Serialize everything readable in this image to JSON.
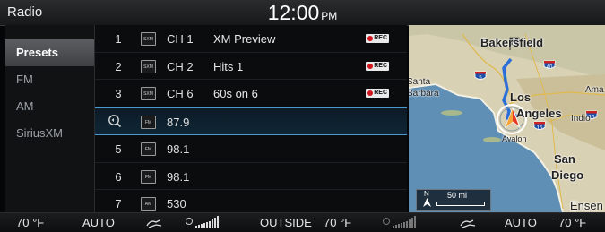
{
  "header": {
    "app_title": "Radio",
    "clock": "12:00",
    "ampm": "PM"
  },
  "sidebar": {
    "items": [
      {
        "label": "Presets",
        "active": true
      },
      {
        "label": "FM",
        "active": false
      },
      {
        "label": "AM",
        "active": false
      },
      {
        "label": "SiriusXM",
        "active": false
      }
    ]
  },
  "presets": [
    {
      "num": "1",
      "badge": "SXM",
      "channel": "CH 1",
      "name": "XM Preview",
      "rec": "REC"
    },
    {
      "num": "2",
      "badge": "SXM",
      "channel": "CH 2",
      "name": "Hits 1",
      "rec": "REC"
    },
    {
      "num": "3",
      "badge": "SXM",
      "channel": "CH 6",
      "name": "60s on 6",
      "rec": "REC"
    },
    {
      "num": "",
      "badge": "FM",
      "channel": "87.9",
      "name": "",
      "rec": ""
    },
    {
      "num": "5",
      "badge": "FM",
      "channel": "98.1",
      "name": "",
      "rec": ""
    },
    {
      "num": "6",
      "badge": "FM",
      "channel": "98.1",
      "name": "",
      "rec": ""
    },
    {
      "num": "7",
      "badge": "AM",
      "channel": "530",
      "name": "",
      "rec": ""
    }
  ],
  "map": {
    "labels": {
      "bakersfield": "Bakersfield",
      "los": "Los",
      "angeles": "Angeles",
      "santa": "Santa",
      "barbara": "Barbara",
      "indio": "Indio",
      "avalon": "Avalon",
      "san": "San",
      "diego": "Diego",
      "ensenada": "Ensen",
      "ama": "Ama"
    },
    "highways": {
      "i5": "5",
      "i40": "40",
      "i15": "15",
      "i10": "10"
    },
    "scale": {
      "north": "N",
      "distance": "50 mi"
    }
  },
  "status": {
    "left_temp": "70 °F",
    "left_mode": "AUTO",
    "outside_label": "OUTSIDE",
    "outside_temp": "70 °F",
    "right_mode": "AUTO",
    "right_temp": "70 °F"
  },
  "colors": {
    "accent": "#4a9ad0",
    "rec_dot": "#d0171d",
    "route": "#2b6fd6"
  }
}
